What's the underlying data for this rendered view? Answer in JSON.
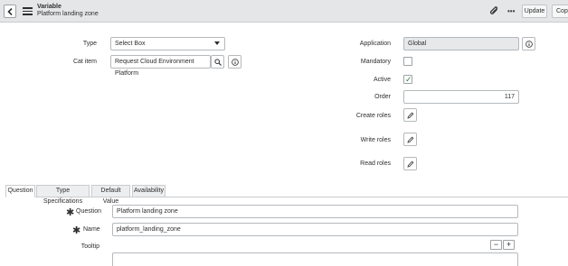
{
  "header": {
    "record_type": "Variable",
    "record_name": "Platform landing zone",
    "update_label": "Update",
    "copy_label": "Copy"
  },
  "form": {
    "type": {
      "label": "Type",
      "value": "Select Box"
    },
    "cat_item": {
      "label": "Cat item",
      "value": "Request Cloud Environment Platform"
    },
    "application": {
      "label": "Application",
      "value": "Global"
    },
    "mandatory": {
      "label": "Mandatory",
      "checked": false
    },
    "active": {
      "label": "Active",
      "checked": true
    },
    "order": {
      "label": "Order",
      "value": "117"
    },
    "create_roles": {
      "label": "Create roles"
    },
    "write_roles": {
      "label": "Write roles"
    },
    "read_roles": {
      "label": "Read roles"
    }
  },
  "tabs": [
    {
      "label": "Question",
      "active": true
    },
    {
      "label": "Type Specifications",
      "active": false
    },
    {
      "label": "Default Value",
      "active": false
    },
    {
      "label": "Availability",
      "active": false
    }
  ],
  "question_section": {
    "question": {
      "label": "Question",
      "value": "Platform landing zone"
    },
    "name": {
      "label": "Name",
      "value": "platform_landing_zone"
    },
    "tooltip": {
      "label": "Tooltip",
      "value": ""
    },
    "minus_label": "−",
    "plus_label": "+",
    "required_marker": "✱"
  },
  "icons": {
    "back": "chevron-left-icon",
    "menu": "hamburger-icon",
    "attachment": "paperclip-icon",
    "more": "ellipsis-icon",
    "search": "magnifier-icon",
    "info": "info-icon",
    "edit": "pencil-icon",
    "check": "checkmark-icon"
  },
  "colors": {
    "header_bg": "#e4e6e7",
    "check_green": "#2b7a3d",
    "readonly_bg": "#e6e8ea"
  }
}
